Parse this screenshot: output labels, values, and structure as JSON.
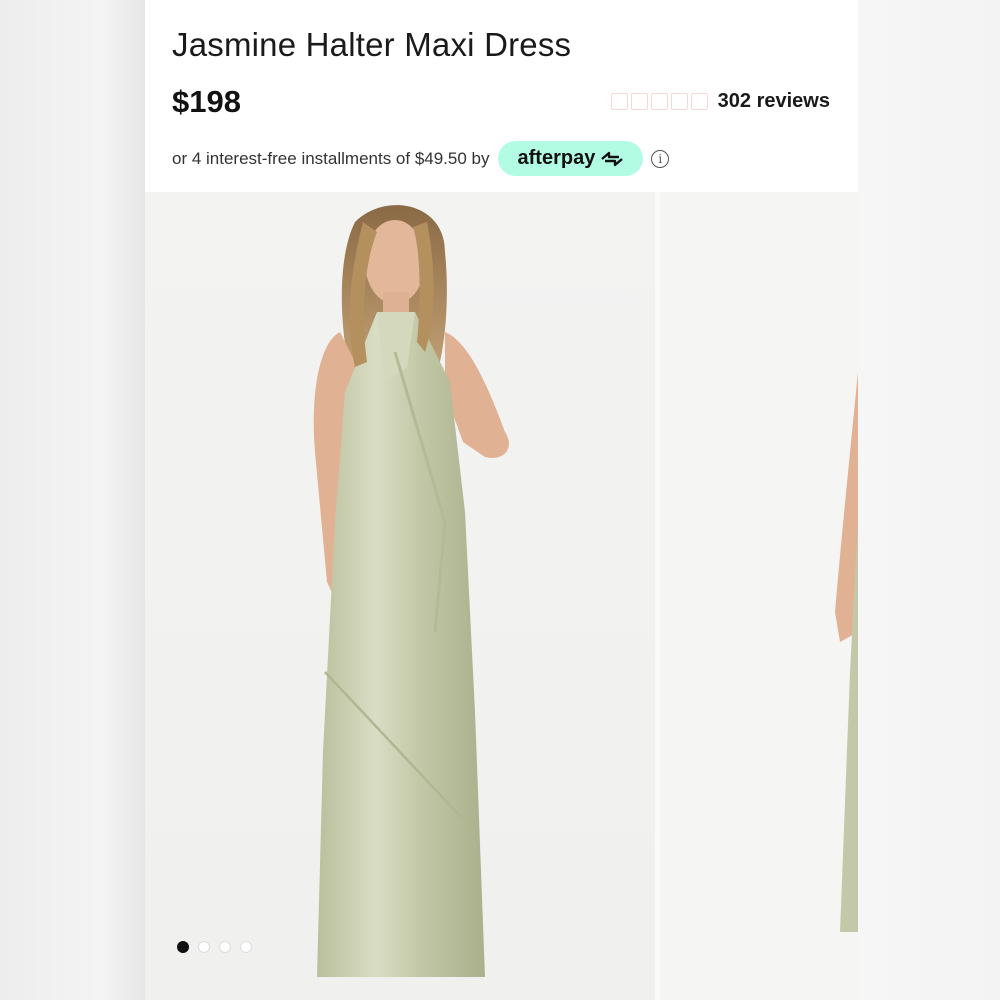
{
  "product": {
    "title": "Jasmine Halter Maxi Dress",
    "price": "$198",
    "rating_value": 0,
    "rating_max": 5,
    "reviews_label": "302 reviews"
  },
  "payment": {
    "installments_text": "or 4 interest-free installments of $49.50 by",
    "provider_label": "afterpay",
    "provider_color": "#b2fce4",
    "info_icon": "info-icon"
  },
  "gallery": {
    "image_count": 4,
    "active_index": 0,
    "dress_color": "#c9cfb0"
  }
}
